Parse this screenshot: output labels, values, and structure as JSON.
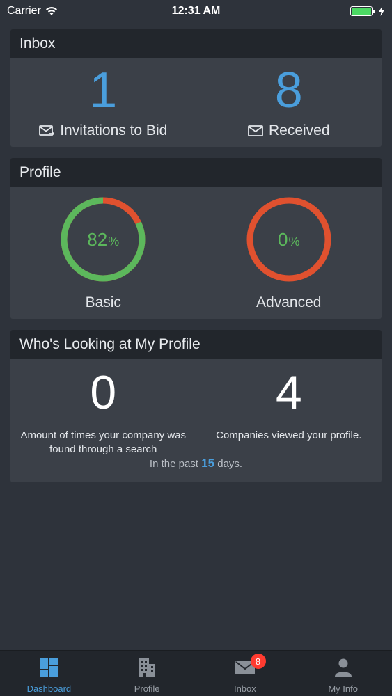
{
  "status_bar": {
    "carrier": "Carrier",
    "time": "12:31 AM"
  },
  "inbox": {
    "title": "Inbox",
    "invitations": {
      "count": "1",
      "label": "Invitations to Bid"
    },
    "received": {
      "count": "8",
      "label": "Received"
    }
  },
  "profile": {
    "title": "Profile",
    "basic": {
      "value": "82",
      "unit": "%",
      "label": "Basic",
      "fraction": 0.82
    },
    "advanced": {
      "value": "0",
      "unit": "%",
      "label": "Advanced",
      "fraction": 0.0
    }
  },
  "looking": {
    "title": "Who's Looking at My Profile",
    "searches": {
      "count": "0",
      "desc": "Amount of times your company was found through a search"
    },
    "views": {
      "count": "4",
      "desc": "Companies viewed your profile."
    },
    "past_prefix": "In the past",
    "past_days": "15",
    "past_suffix": "days."
  },
  "tabs": [
    {
      "label": "Dashboard",
      "icon": "dashboard-icon",
      "active": true
    },
    {
      "label": "Profile",
      "icon": "building-icon",
      "active": false
    },
    {
      "label": "Inbox",
      "icon": "mail-icon",
      "active": false,
      "badge": "8"
    },
    {
      "label": "My Info",
      "icon": "person-icon",
      "active": false
    }
  ],
  "colors": {
    "accent": "#4a9edc",
    "complete": "#5cb85c",
    "incomplete": "#e0512f",
    "badge": "#ff3b30"
  }
}
